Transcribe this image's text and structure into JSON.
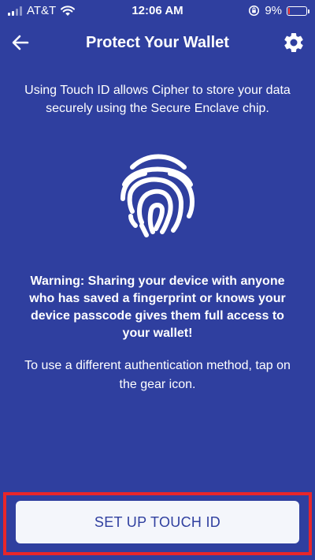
{
  "status_bar": {
    "carrier": "AT&T",
    "time": "12:06 AM",
    "battery_percent": "9%",
    "battery_level": 0.09,
    "battery_color": "#ff3b30"
  },
  "nav": {
    "title": "Protect Your Wallet",
    "back_icon": "arrow-left-icon",
    "settings_icon": "gear-icon"
  },
  "content": {
    "intro": "Using Touch ID allows Cipher to store your data securely using the Secure Enclave chip.",
    "fingerprint_icon": "fingerprint-icon",
    "warning": "Warning: Sharing your device with anyone who has saved a fingerprint or knows your device passcode gives them full access to your wallet!",
    "alternative": "To use a different authentication method, tap on the gear icon."
  },
  "actions": {
    "setup_button": "SET UP TOUCH ID"
  },
  "colors": {
    "background": "#2f3f9f",
    "button_bg": "#f4f6fb",
    "button_text": "#2f3f9f",
    "highlight": "#e8262a"
  }
}
